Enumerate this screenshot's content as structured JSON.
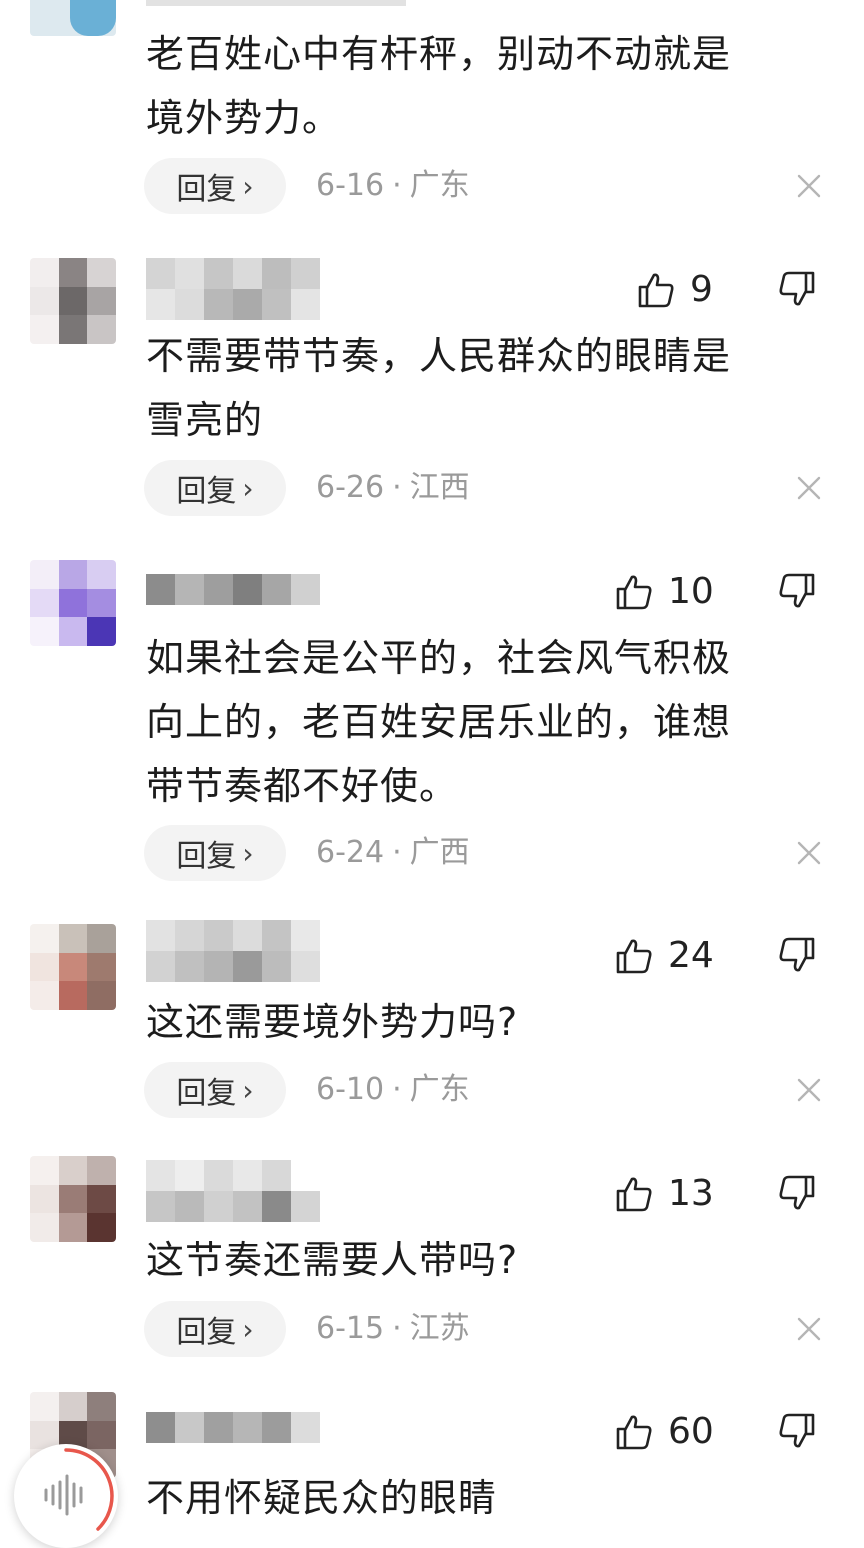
{
  "comments": [
    {
      "content": "老百姓心中有杆秤，别动不动就是\n境外势力。",
      "reply_label": "回复",
      "date": "6-16",
      "location": "广东"
    },
    {
      "likes": "9",
      "content": "不需要带节奏，人民群众的眼睛是\n雪亮的",
      "reply_label": "回复",
      "date": "6-26",
      "location": "江西"
    },
    {
      "likes": "10",
      "content": "如果社会是公平的，社会风气积极\n向上的，老百姓安居乐业的，谁想\n带节奏都不好使。",
      "reply_label": "回复",
      "date": "6-24",
      "location": "广西"
    },
    {
      "likes": "24",
      "content": "这还需要境外势力吗?",
      "reply_label": "回复",
      "date": "6-10",
      "location": "广东"
    },
    {
      "likes": "13",
      "content": "这节奏还需要人带吗?",
      "reply_label": "回复",
      "date": "6-15",
      "location": "江苏"
    },
    {
      "likes": "60",
      "content": "不用怀疑民众的眼睛"
    }
  ],
  "icons": {
    "like": "thumbs-up-icon",
    "dislike": "thumbs-down-icon",
    "close": "close-icon",
    "reply_chevron": "chevron-right-icon",
    "audio": "audio-wave-icon"
  },
  "colors": {
    "text": "#1c1c1c",
    "meta": "#9a9a9a",
    "reply_bg": "#f3f3f3",
    "audio_ring": "#e8574c"
  }
}
